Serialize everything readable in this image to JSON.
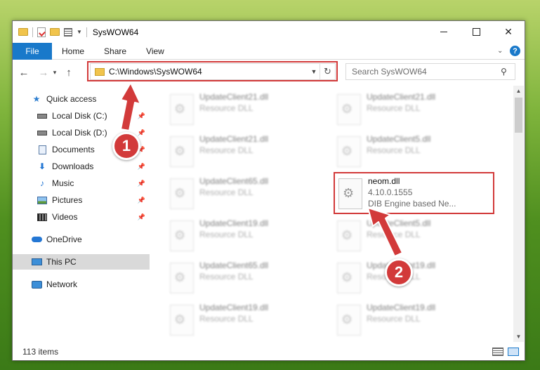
{
  "window": {
    "title": "SysWOW64",
    "controls": {
      "minimize": "—",
      "maximize": "☐",
      "close": "✕"
    }
  },
  "ribbon": {
    "tabs": [
      {
        "label": "File"
      },
      {
        "label": "Home"
      },
      {
        "label": "Share"
      },
      {
        "label": "View"
      }
    ],
    "help": "?"
  },
  "navigation": {
    "back": "←",
    "forward": "→",
    "recent": "▾",
    "up": "↑",
    "address": "C:\\Windows\\SysWOW64",
    "address_dropdown": "▼",
    "refresh": "↻",
    "search_placeholder": "Search SysWOW64",
    "search_icon": "🔍"
  },
  "sidebar": {
    "items": [
      {
        "label": "Quick access",
        "icon": "star-icon",
        "pinned": false
      },
      {
        "label": "Local Disk (C:)",
        "icon": "disk-icon",
        "pinned": true
      },
      {
        "label": "Local Disk (D:)",
        "icon": "disk-icon",
        "pinned": true
      },
      {
        "label": "Documents",
        "icon": "documents-icon",
        "pinned": true
      },
      {
        "label": "Downloads",
        "icon": "downloads-icon",
        "pinned": true
      },
      {
        "label": "Music",
        "icon": "music-icon",
        "pinned": true
      },
      {
        "label": "Pictures",
        "icon": "pictures-icon",
        "pinned": true
      },
      {
        "label": "Videos",
        "icon": "videos-icon",
        "pinned": true
      },
      {
        "label": "OneDrive",
        "icon": "onedrive-icon",
        "pinned": false
      },
      {
        "label": "This PC",
        "icon": "this-pc-icon",
        "pinned": false,
        "selected": true
      },
      {
        "label": "Network",
        "icon": "network-icon",
        "pinned": false
      }
    ]
  },
  "files": {
    "left": [
      {
        "name": "UpdateClient21.dll",
        "type": "Resource DLL"
      },
      {
        "name": "UpdateClient21.dll",
        "type": "Resource DLL"
      },
      {
        "name": "UpdateClient65.dll",
        "type": "Resource DLL"
      },
      {
        "name": "UpdateClient19.dll",
        "type": "Resource DLL"
      },
      {
        "name": "UpdateClient65.dll",
        "type": "Resource DLL"
      },
      {
        "name": "UpdateClient19.dll",
        "type": "Resource DLL"
      }
    ],
    "right": [
      {
        "name": "UpdateClient21.dll",
        "type": "Resource DLL"
      },
      {
        "name": "UpdateClient5.dll",
        "type": "Resource DLL"
      },
      {
        "name": "UpdateClient5.dll",
        "type": "Resource DLL"
      },
      {
        "name": "UpdateClient19.dll",
        "type": "Resource DLL"
      },
      {
        "name": "UpdateClient19.dll",
        "type": "Resource DLL"
      }
    ],
    "highlighted": {
      "name": "neom.dll",
      "version": "4.10.0.1555",
      "description": "DIB Engine based Ne..."
    }
  },
  "status": {
    "item_count": "113 items"
  },
  "annotations": {
    "badge_1": "1",
    "badge_2": "2",
    "color": "#d23a3a"
  }
}
